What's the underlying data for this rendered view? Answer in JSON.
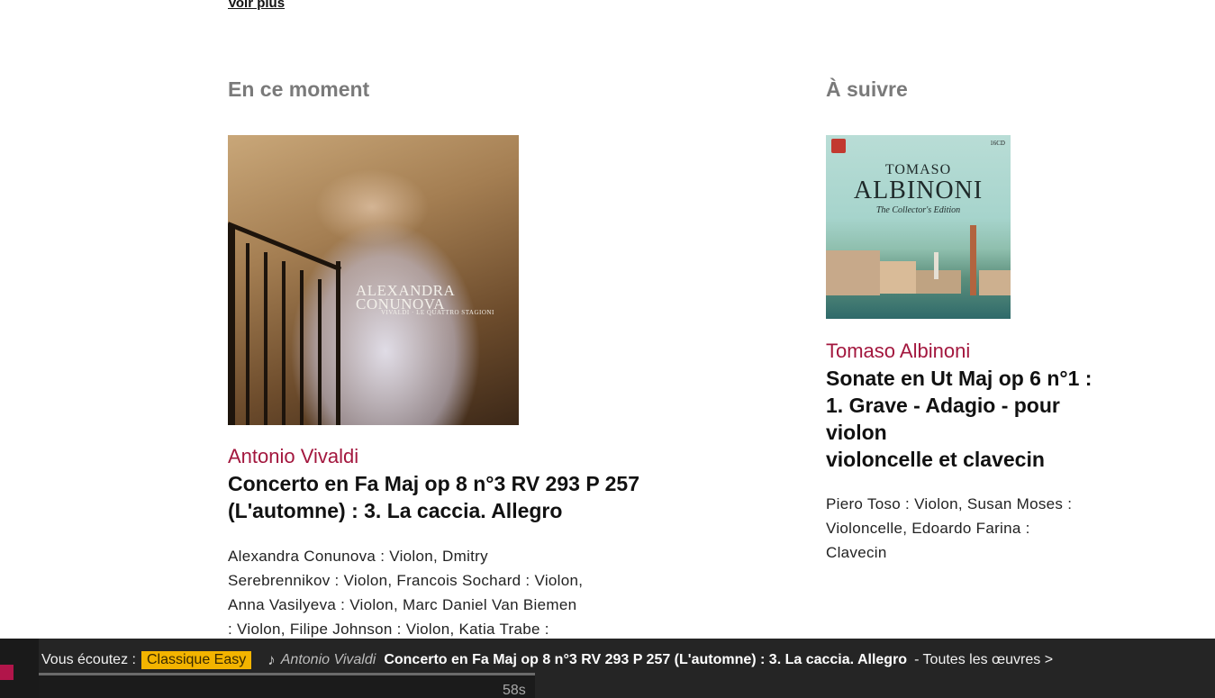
{
  "top_link": {
    "label": "Voir plus"
  },
  "now": {
    "heading": "En ce moment",
    "album_title_line1": "ALEXANDRA",
    "album_title_line2": "CONUNOVA",
    "album_subtitle": "VIVALDI · LE QUATTRO STAGIONI",
    "composer": "Antonio Vivaldi",
    "work_line1": "Concerto en Fa Maj op 8 n°3 RV 293 P 257",
    "work_line2": "(L'automne) : 3. La caccia. Allegro",
    "performers": [
      "Alexandra Conunova : Violon, Dmitry",
      "Serebrennikov : Violon, Francois Sochard : Violon,",
      "Anna Vasilyeva : Violon, Marc Daniel Van Biemen",
      ": Violon, Filipe Johnson : Violon, Katia Trabe :"
    ]
  },
  "next": {
    "heading": "À suivre",
    "album_title_line1": "TOMASO",
    "album_title_line2": "ALBINONI",
    "album_title_line3": "The Collector's Edition",
    "album_badge": "16CD",
    "composer": "Tomaso Albinoni",
    "work_line1": "Sonate en Ut Maj op 6 n°1 :",
    "work_line2": "1. Grave - Adagio - pour violon",
    "work_line3": "violoncelle et clavecin",
    "performers": [
      "Piero Toso : Violon, Susan Moses :",
      "Violoncelle, Edoardo Farina :",
      "Clavecin"
    ]
  },
  "player": {
    "label": "Vous écoutez :",
    "station": "Classique Easy",
    "note_icon": "♪",
    "composer": "Antonio Vivaldi",
    "work": "Concerto en Fa Maj op 8 n°3 RV 293 P 257 (L'automne) : 3. La caccia. Allegro",
    "link": "- Toutes les œuvres >",
    "time": "58s",
    "progress_fraction": 1.0,
    "colors": {
      "bar": "#252525",
      "station": "#f3b400",
      "accent": "#b1154a"
    }
  },
  "colors": {
    "composer": "#a3173e",
    "heading": "#7a7a7a"
  }
}
